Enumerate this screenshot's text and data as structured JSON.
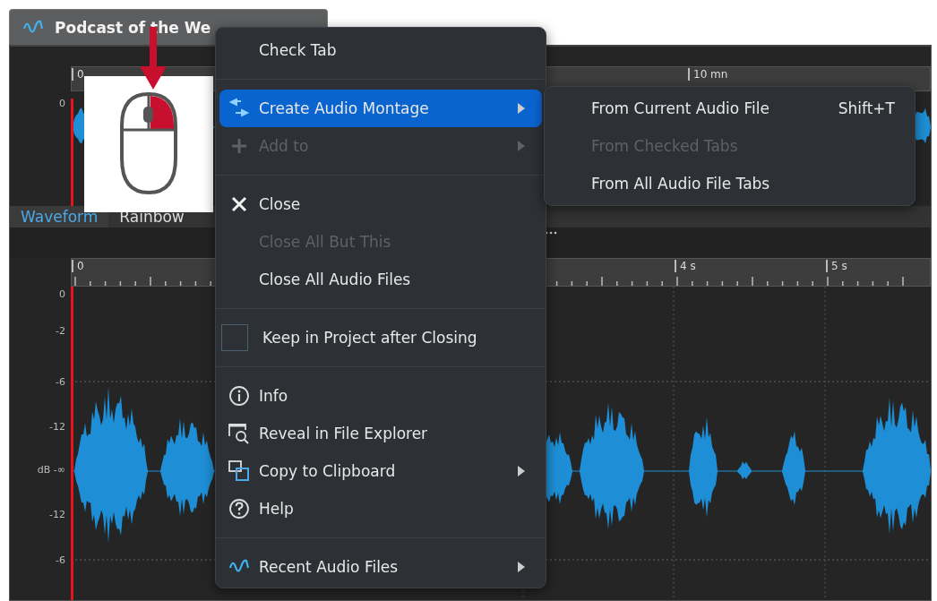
{
  "tab": {
    "title": "Podcast of the We"
  },
  "overview": {
    "ruler_labels": [
      "0",
      "10 mn"
    ],
    "db_labels": [
      "0"
    ]
  },
  "view_tabs": [
    {
      "label": "Waveform",
      "selected": true
    },
    {
      "label": "Rainbow",
      "selected": false
    }
  ],
  "main": {
    "ruler_labels": [
      "0",
      "4 s",
      "5 s"
    ],
    "db_labels": [
      "0",
      "-2",
      "-6",
      "-12",
      "dB -∞",
      "-12",
      "-6"
    ]
  },
  "context_menu": {
    "items": [
      {
        "kind": "item",
        "label": "Check Tab",
        "disabled": false,
        "selected": false,
        "submenu": false
      },
      {
        "kind": "separator"
      },
      {
        "kind": "item",
        "label": "Create Audio Montage",
        "disabled": false,
        "selected": true,
        "submenu": true
      },
      {
        "kind": "item",
        "label": "Add to",
        "disabled": true,
        "selected": false,
        "submenu": true
      },
      {
        "kind": "separator"
      },
      {
        "kind": "item",
        "label": "Close",
        "disabled": false,
        "selected": false,
        "submenu": false
      },
      {
        "kind": "item",
        "label": "Close All But This",
        "disabled": true,
        "selected": false,
        "submenu": false
      },
      {
        "kind": "item",
        "label": "Close All Audio Files",
        "disabled": false,
        "selected": false,
        "submenu": false
      },
      {
        "kind": "separator"
      },
      {
        "kind": "checkbox",
        "label": "Keep in Project after Closing",
        "checked": false
      },
      {
        "kind": "separator"
      },
      {
        "kind": "item",
        "label": "Info",
        "disabled": false,
        "selected": false,
        "submenu": false
      },
      {
        "kind": "item",
        "label": "Reveal in File Explorer",
        "disabled": false,
        "selected": false,
        "submenu": false
      },
      {
        "kind": "item",
        "label": "Copy to Clipboard",
        "disabled": false,
        "selected": false,
        "submenu": true
      },
      {
        "kind": "item",
        "label": "Help",
        "disabled": false,
        "selected": false,
        "submenu": false
      },
      {
        "kind": "separator"
      },
      {
        "kind": "item",
        "label": "Recent Audio Files",
        "disabled": false,
        "selected": false,
        "submenu": true
      }
    ]
  },
  "submenu": {
    "items": [
      {
        "label": "From Current Audio File",
        "shortcut": "Shift+T",
        "disabled": false
      },
      {
        "label": "From Checked Tabs",
        "disabled": true
      },
      {
        "label": "From All Audio File Tabs",
        "disabled": false
      }
    ]
  }
}
